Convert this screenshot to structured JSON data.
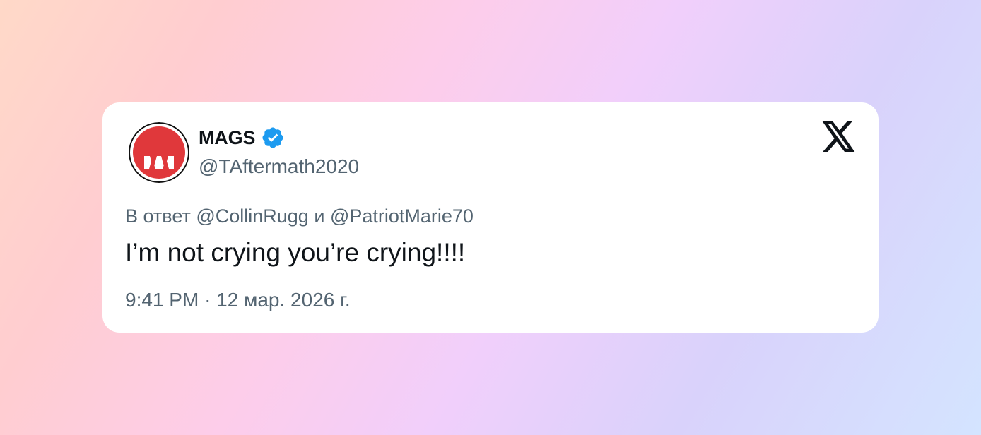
{
  "tweet": {
    "display_name": "MAGS",
    "handle": "@TAftermath2020",
    "verified": true,
    "reply_prefix": "В ответ",
    "reply_to_1": "@CollinRugg",
    "reply_joiner": "и",
    "reply_to_2": "@PatriotMarie70",
    "text": "I’m not crying you’re crying!!!!",
    "time": "9:41 PM",
    "separator": "·",
    "date": "12 мар. 2026 г."
  },
  "icons": {
    "avatar": "mags-logo-avatar",
    "verified": "verified-badge-icon",
    "platform": "x-logo-icon"
  },
  "colors": {
    "card_bg": "#ffffff",
    "text_primary": "#0f1419",
    "text_secondary": "#536471",
    "verified_blue": "#1d9bf0",
    "avatar_red": "#e0383b"
  }
}
